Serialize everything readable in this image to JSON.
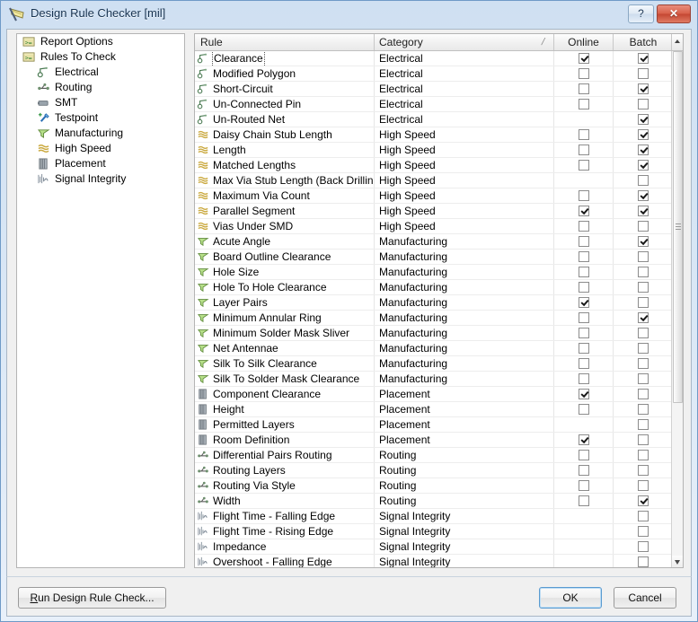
{
  "window": {
    "title": "Design Rule Checker [mil]",
    "title_icon": "drc-flag-icon",
    "help_label": "?",
    "close_label": "✕"
  },
  "sidebar": {
    "items": [
      {
        "label": "Report Options",
        "icon": "report-options-icon",
        "level": 0
      },
      {
        "label": "Rules To Check",
        "icon": "rules-to-check-icon",
        "level": 0
      },
      {
        "label": "Electrical",
        "icon": "electrical-icon",
        "level": 1
      },
      {
        "label": "Routing",
        "icon": "routing-icon",
        "level": 1
      },
      {
        "label": "SMT",
        "icon": "smt-icon",
        "level": 1
      },
      {
        "label": "Testpoint",
        "icon": "testpoint-icon",
        "level": 1
      },
      {
        "label": "Manufacturing",
        "icon": "manufacturing-icon",
        "level": 1
      },
      {
        "label": "High Speed",
        "icon": "high-speed-icon",
        "level": 1
      },
      {
        "label": "Placement",
        "icon": "placement-icon",
        "level": 1
      },
      {
        "label": "Signal Integrity",
        "icon": "signal-integrity-icon",
        "level": 1
      }
    ]
  },
  "grid": {
    "columns": {
      "rule": "Rule",
      "category": "Category",
      "online": "Online",
      "batch": "Batch"
    },
    "sort_indicator": "/",
    "rows": [
      {
        "rule": "Clearance",
        "category": "Electrical",
        "icon": "electrical-icon",
        "online": "checked",
        "batch": "checked",
        "focused": true
      },
      {
        "rule": "Modified Polygon",
        "category": "Electrical",
        "icon": "electrical-icon",
        "online": "unchecked",
        "batch": "unchecked"
      },
      {
        "rule": "Short-Circuit",
        "category": "Electrical",
        "icon": "electrical-icon",
        "online": "unchecked",
        "batch": "checked"
      },
      {
        "rule": "Un-Connected Pin",
        "category": "Electrical",
        "icon": "electrical-icon",
        "online": "unchecked",
        "batch": "unchecked"
      },
      {
        "rule": "Un-Routed Net",
        "category": "Electrical",
        "icon": "electrical-icon",
        "online": "none",
        "batch": "checked"
      },
      {
        "rule": "Daisy Chain Stub Length",
        "category": "High Speed",
        "icon": "high-speed-icon",
        "online": "unchecked",
        "batch": "checked"
      },
      {
        "rule": "Length",
        "category": "High Speed",
        "icon": "high-speed-icon",
        "online": "unchecked",
        "batch": "checked"
      },
      {
        "rule": "Matched Lengths",
        "category": "High Speed",
        "icon": "high-speed-icon",
        "online": "unchecked",
        "batch": "checked"
      },
      {
        "rule": "Max Via Stub Length (Back Drilling)",
        "category": "High Speed",
        "icon": "high-speed-icon",
        "online": "none",
        "batch": "unchecked"
      },
      {
        "rule": "Maximum Via Count",
        "category": "High Speed",
        "icon": "high-speed-icon",
        "online": "unchecked",
        "batch": "checked"
      },
      {
        "rule": "Parallel Segment",
        "category": "High Speed",
        "icon": "high-speed-icon",
        "online": "checked",
        "batch": "checked"
      },
      {
        "rule": "Vias Under SMD",
        "category": "High Speed",
        "icon": "high-speed-icon",
        "online": "unchecked",
        "batch": "unchecked"
      },
      {
        "rule": "Acute Angle",
        "category": "Manufacturing",
        "icon": "manufacturing-icon",
        "online": "unchecked",
        "batch": "checked"
      },
      {
        "rule": "Board Outline Clearance",
        "category": "Manufacturing",
        "icon": "manufacturing-icon",
        "online": "unchecked",
        "batch": "unchecked"
      },
      {
        "rule": "Hole Size",
        "category": "Manufacturing",
        "icon": "manufacturing-icon",
        "online": "unchecked",
        "batch": "unchecked"
      },
      {
        "rule": "Hole To Hole Clearance",
        "category": "Manufacturing",
        "icon": "manufacturing-icon",
        "online": "unchecked",
        "batch": "unchecked"
      },
      {
        "rule": "Layer Pairs",
        "category": "Manufacturing",
        "icon": "manufacturing-icon",
        "online": "checked",
        "batch": "unchecked"
      },
      {
        "rule": "Minimum Annular Ring",
        "category": "Manufacturing",
        "icon": "manufacturing-icon",
        "online": "unchecked",
        "batch": "checked"
      },
      {
        "rule": "Minimum Solder Mask Sliver",
        "category": "Manufacturing",
        "icon": "manufacturing-icon",
        "online": "unchecked",
        "batch": "unchecked"
      },
      {
        "rule": "Net Antennae",
        "category": "Manufacturing",
        "icon": "manufacturing-icon",
        "online": "unchecked",
        "batch": "unchecked"
      },
      {
        "rule": "Silk To Silk Clearance",
        "category": "Manufacturing",
        "icon": "manufacturing-icon",
        "online": "unchecked",
        "batch": "unchecked"
      },
      {
        "rule": "Silk To Solder Mask Clearance",
        "category": "Manufacturing",
        "icon": "manufacturing-icon",
        "online": "unchecked",
        "batch": "unchecked"
      },
      {
        "rule": "Component Clearance",
        "category": "Placement",
        "icon": "placement-icon",
        "online": "checked",
        "batch": "unchecked"
      },
      {
        "rule": "Height",
        "category": "Placement",
        "icon": "placement-icon",
        "online": "unchecked",
        "batch": "unchecked"
      },
      {
        "rule": "Permitted Layers",
        "category": "Placement",
        "icon": "placement-icon",
        "online": "none",
        "batch": "unchecked"
      },
      {
        "rule": "Room Definition",
        "category": "Placement",
        "icon": "placement-icon",
        "online": "checked",
        "batch": "unchecked"
      },
      {
        "rule": "Differential Pairs Routing",
        "category": "Routing",
        "icon": "routing-icon",
        "online": "unchecked",
        "batch": "unchecked"
      },
      {
        "rule": "Routing Layers",
        "category": "Routing",
        "icon": "routing-icon",
        "online": "unchecked",
        "batch": "unchecked"
      },
      {
        "rule": "Routing Via Style",
        "category": "Routing",
        "icon": "routing-icon",
        "online": "unchecked",
        "batch": "unchecked"
      },
      {
        "rule": "Width",
        "category": "Routing",
        "icon": "routing-icon",
        "online": "unchecked",
        "batch": "checked"
      },
      {
        "rule": "Flight Time - Falling Edge",
        "category": "Signal Integrity",
        "icon": "signal-integrity-icon",
        "online": "none",
        "batch": "unchecked"
      },
      {
        "rule": "Flight Time - Rising Edge",
        "category": "Signal Integrity",
        "icon": "signal-integrity-icon",
        "online": "none",
        "batch": "unchecked"
      },
      {
        "rule": "Impedance",
        "category": "Signal Integrity",
        "icon": "signal-integrity-icon",
        "online": "none",
        "batch": "unchecked"
      },
      {
        "rule": "Overshoot - Falling Edge",
        "category": "Signal Integrity",
        "icon": "signal-integrity-icon",
        "online": "none",
        "batch": "unchecked"
      }
    ]
  },
  "footer": {
    "run_accel": "R",
    "run_rest": "un Design Rule Check...",
    "ok": "OK",
    "cancel": "Cancel"
  }
}
